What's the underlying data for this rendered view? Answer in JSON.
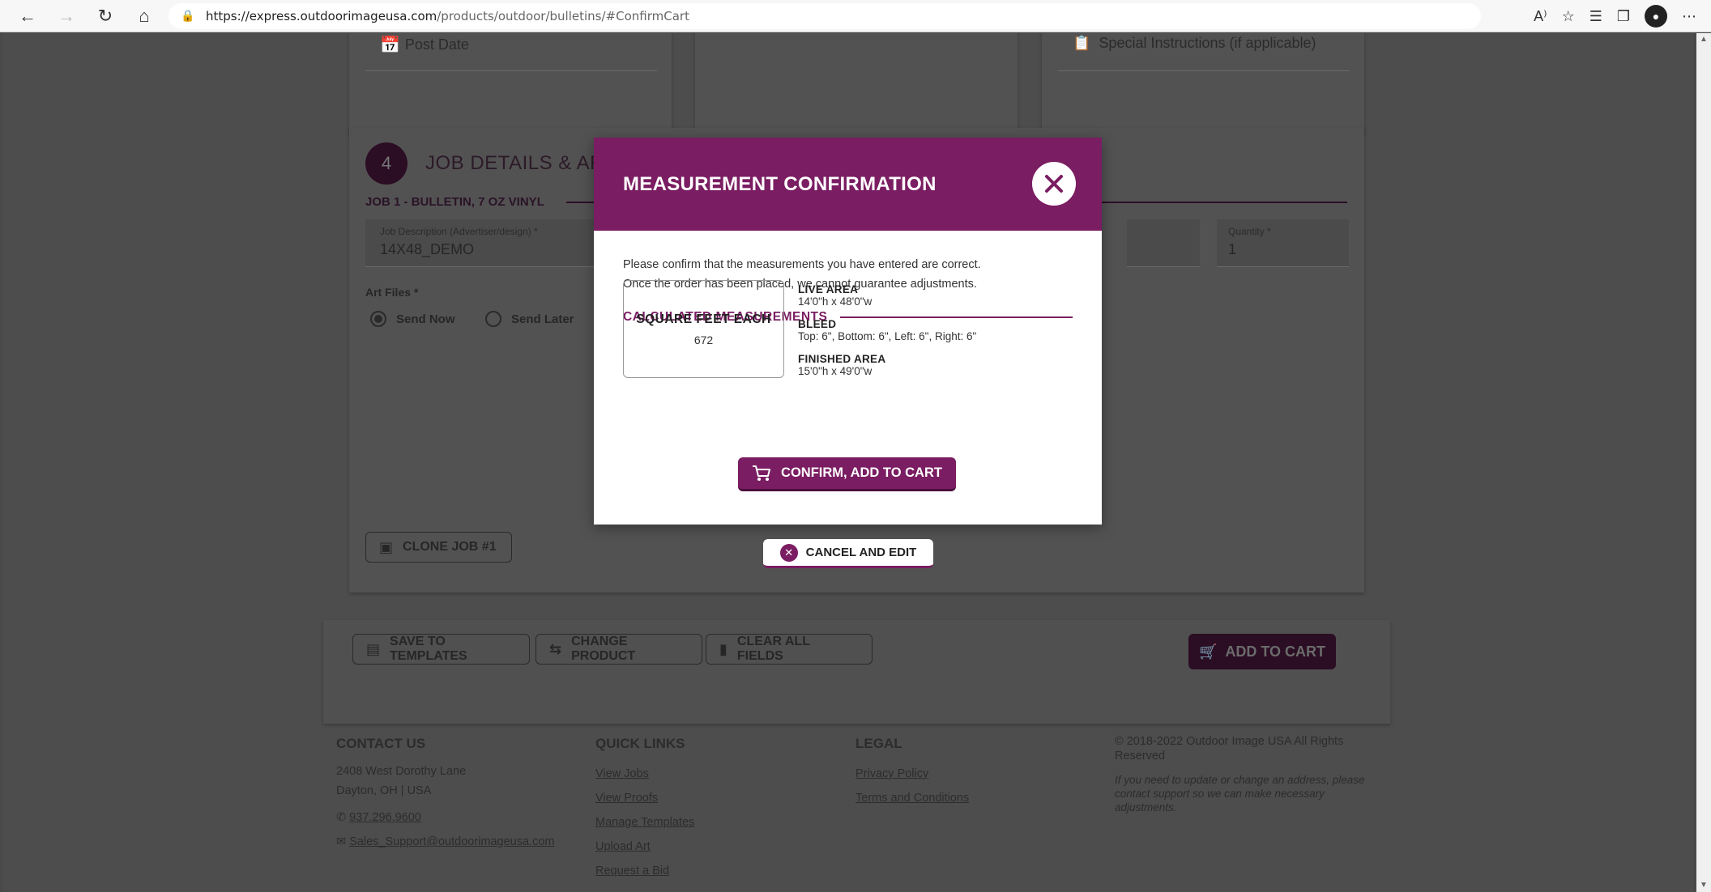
{
  "browser": {
    "url_domain": "https://express.outdoorimageusa.com",
    "url_path": "/products/outdoor/bulletins/#ConfirmCart",
    "read_aloud": "A⁾"
  },
  "form": {
    "post_date_label": "Post Date",
    "special_instructions_label": "Special Instructions (if applicable)",
    "step_number": "4",
    "section_title": "JOB DETAILS & AR",
    "job_label": "JOB 1 - BULLETIN, 7 OZ VINYL",
    "job_description_label": "Job Description (Advertiser/design) *",
    "job_description_value": "14X48_DEMO",
    "quantity_label": "Quantity *",
    "quantity_value": "1",
    "art_files_label": "Art Files *",
    "send_now_label": "Send Now",
    "send_later_label": "Send Later",
    "clone_job_label": "CLONE JOB #1"
  },
  "actions": {
    "save_templates": "SAVE TO TEMPLATES",
    "change_product": "CHANGE PRODUCT",
    "clear_fields": "CLEAR ALL FIELDS",
    "add_to_cart": "ADD TO CART"
  },
  "footer": {
    "contact_title": "CONTACT US",
    "address_line1": "2408 West Dorothy Lane",
    "address_line2": "Dayton, OH | USA",
    "phone": "937.296.9600",
    "email": "Sales_Support@outdoorimageusa.com",
    "quick_links_title": "QUICK LINKS",
    "quick_links": [
      "View Jobs",
      "View Proofs",
      "Manage Templates",
      "Upload Art",
      "Request a Bid"
    ],
    "legal_title": "LEGAL",
    "legal_links": [
      "Privacy Policy",
      "Terms and Conditions"
    ],
    "copyright": "© 2018-2022 Outdoor Image USA All Rights Reserved",
    "address_note": "If you need to update or change an address, please contact support so we can make necessary adjustments."
  },
  "modal": {
    "title": "MEASUREMENT CONFIRMATION",
    "line1": "Please confirm that the measurements you have entered are correct.",
    "line2": "Once the order has been placed, we cannot guarantee adjustments.",
    "calc_title": "CALCULATED MEASUREMENTS",
    "sq_label": "SQUARE FEET EACH",
    "sq_value": "672",
    "live_area_label": "LIVE AREA",
    "live_area_value": "14'0\"h x 48'0\"w",
    "bleed_label": "BLEED",
    "bleed_value": "Top: 6\", Bottom: 6\", Left: 6\", Right: 6\"",
    "finished_label": "FINISHED AREA",
    "finished_value": "15'0\"h x 49'0\"w",
    "confirm_label": "CONFIRM, ADD TO CART",
    "cancel_label": "CANCEL AND EDIT"
  },
  "colors": {
    "brand_purple": "#7a1d62",
    "overlay_gray": "#4d4d4d"
  }
}
